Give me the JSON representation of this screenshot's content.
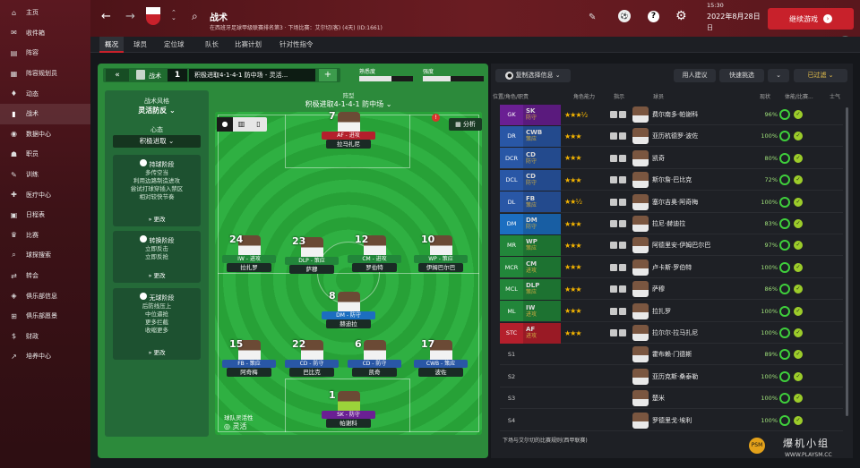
{
  "app": {
    "title": "战术",
    "subtitle": "在西班牙足球甲级联赛排名第3 · 下场比赛：艾尔切(客) (4天) (ID:1661)",
    "time": "2022年8月28日",
    "day": "日",
    "clock": "15:30",
    "continue_label": "继续游戏",
    "badge_count": "6",
    "colors": {
      "accent": "#c8212b",
      "sidebar": "#4d1318"
    }
  },
  "sidebar": {
    "items": [
      {
        "icon": "home-icon",
        "glyph": "⌂",
        "label": "主页"
      },
      {
        "icon": "inbox-icon",
        "glyph": "✉",
        "label": "收件箱"
      },
      {
        "icon": "squad-icon",
        "glyph": "▤",
        "label": "阵容"
      },
      {
        "icon": "squad-plan-icon",
        "glyph": "▦",
        "label": "阵容规划员"
      },
      {
        "icon": "dynamics-icon",
        "glyph": "♦",
        "label": "动态"
      },
      {
        "icon": "tactics-icon",
        "glyph": "▮",
        "label": "战术"
      },
      {
        "icon": "data-hub-icon",
        "glyph": "◉",
        "label": "数据中心"
      },
      {
        "icon": "staff-icon",
        "glyph": "☗",
        "label": "职员"
      },
      {
        "icon": "training-icon",
        "glyph": "✎",
        "label": "训练"
      },
      {
        "icon": "medical-icon",
        "glyph": "✚",
        "label": "医疗中心"
      },
      {
        "icon": "schedule-icon",
        "glyph": "▣",
        "label": "日程表"
      },
      {
        "icon": "competitions-icon",
        "glyph": "♛",
        "label": "比赛"
      },
      {
        "icon": "scouting-icon",
        "glyph": "⌕",
        "label": "球探搜索"
      },
      {
        "icon": "transfers-icon",
        "glyph": "⇄",
        "label": "转会"
      },
      {
        "icon": "club-info-icon",
        "glyph": "◈",
        "label": "俱乐部信息"
      },
      {
        "icon": "club-vision-icon",
        "glyph": "⊞",
        "label": "俱乐部愿景"
      },
      {
        "icon": "finances-icon",
        "glyph": "$",
        "label": "财政"
      },
      {
        "icon": "dev-centre-icon",
        "glyph": "↗",
        "label": "培养中心"
      }
    ]
  },
  "tabs": [
    "概况",
    "球员",
    "定位球",
    "队长",
    "比赛计划",
    "针对性指令"
  ],
  "tactic": {
    "header_label": "战术",
    "slot": "1",
    "name": "积极进取4-1-4-1 防中场 - 灵活...",
    "familiarity_label": "熟悉度",
    "intensity_label": "强度",
    "formation_label": "阵型",
    "formation": "积极进取4-1-4-1 防中场",
    "style_label": "战术风格",
    "style": "灵活防反",
    "mentality_label": "心态",
    "mentality": "积极进取",
    "phases": [
      {
        "title": "持球阶段",
        "lines": [
          "多传空当",
          "利用边路制造进攻",
          "尝试打球穿插入禁区",
          "相对较快节奏"
        ],
        "more": "更改"
      },
      {
        "title": "转换阶段",
        "lines": [
          "立即反击",
          "立即反抢"
        ],
        "more": "更改"
      },
      {
        "title": "无球阶段",
        "lines": [
          "后防线压上",
          "中位逼抢",
          "更多拦截",
          "收缩更多"
        ],
        "more": "更改"
      }
    ],
    "analysis_label": "分析",
    "fluidity_label": "球队灵活性",
    "fluidity": "灵活"
  },
  "pitch_players": [
    {
      "num": "7",
      "role": "AF - 进攻",
      "cls": "at",
      "name": "拉马扎尼"
    },
    {
      "num": "24",
      "role": "IW - 进攻",
      "cls": "mf",
      "name": "拉扎罗"
    },
    {
      "num": "23",
      "role": "DLP - 策应",
      "cls": "mf",
      "name": "萨穆"
    },
    {
      "num": "12",
      "role": "CM - 进攻",
      "cls": "mf",
      "name": "罗伯特"
    },
    {
      "num": "10",
      "role": "WP - 策应",
      "cls": "mf",
      "name": "伊姆巴尔巴"
    },
    {
      "num": "8",
      "role": "DM - 防守",
      "cls": "dm",
      "name": "赫迪拉"
    },
    {
      "num": "15",
      "role": "FB - 策应",
      "cls": "df",
      "name": "阿奇梅"
    },
    {
      "num": "22",
      "role": "CD - 防守",
      "cls": "df",
      "name": "巴比克"
    },
    {
      "num": "6",
      "role": "CD - 防守",
      "cls": "df",
      "name": "凯奇"
    },
    {
      "num": "17",
      "role": "CWB - 策应",
      "cls": "df",
      "name": "波佐"
    },
    {
      "num": "1",
      "role": "SK - 防守",
      "cls": "gk",
      "name": "帕谢科"
    }
  ],
  "selection": {
    "copy_label": "复制选择信息",
    "advice_label": "用人建议",
    "quick_label": "快速挑选",
    "filter_label": "已过滤",
    "headers": {
      "pos": "位置/角色/职责",
      "ability": "角色能力",
      "instr": "指示",
      "player": "球员",
      "state": "现状",
      "fitness": "体能/比赛...",
      "morale": "士气"
    },
    "rows": [
      {
        "pos": "GK",
        "r1": "SK",
        "r2": "防守",
        "stars": "★★★½",
        "name": "费尔南多·帕谢科",
        "state": "",
        "fit": "96%",
        "cls": "gk"
      },
      {
        "pos": "DR",
        "r1": "CWB",
        "r2": "策应",
        "stars": "★★★",
        "name": "亚历杭德罗·波佐",
        "state": "",
        "fit": "100%",
        "cls": "df"
      },
      {
        "pos": "DCR",
        "r1": "CD",
        "r2": "防守",
        "stars": "★★★",
        "name": "凯奇",
        "state": "",
        "fit": "80%",
        "cls": "df"
      },
      {
        "pos": "DCL",
        "r1": "CD",
        "r2": "防守",
        "stars": "★★★",
        "name": "斯尔詹·巴比克",
        "state": "",
        "fit": "72%",
        "cls": "df"
      },
      {
        "pos": "DL",
        "r1": "FB",
        "r2": "策应",
        "stars": "★★½",
        "name": "塞尔吉奥·阿奇梅",
        "state": "",
        "fit": "100%",
        "cls": "df"
      },
      {
        "pos": "DM",
        "r1": "DM",
        "r2": "防守",
        "stars": "★★★",
        "name": "拉尼·赫迪拉",
        "state": "",
        "fit": "83%",
        "cls": "dm"
      },
      {
        "pos": "MR",
        "r1": "WP",
        "r2": "策应",
        "stars": "★★★",
        "name": "阿德里安·伊姆巴尔巴",
        "state": "",
        "fit": "97%",
        "cls": "mf"
      },
      {
        "pos": "MCR",
        "r1": "CM",
        "r2": "进攻",
        "stars": "★★★",
        "name": "卢卡斯·罗伯特",
        "state": "",
        "fit": "100%",
        "cls": "mf"
      },
      {
        "pos": "MCL",
        "r1": "DLP",
        "r2": "策应",
        "stars": "★★★",
        "name": "萨穆",
        "state": "",
        "fit": "86%",
        "cls": "mf"
      },
      {
        "pos": "ML",
        "r1": "IW",
        "r2": "进攻",
        "stars": "★★★",
        "name": "拉扎罗",
        "state": "",
        "fit": "100%",
        "cls": "mf"
      },
      {
        "pos": "STC",
        "r1": "AF",
        "r2": "进攻",
        "stars": "★★★",
        "name": "拉尔尔·拉马扎尼",
        "state": "",
        "fit": "100%",
        "cls": "at"
      },
      {
        "pos": "S1",
        "r1": "",
        "r2": "",
        "stars": "",
        "name": "霍布赖·门德斯",
        "state": "",
        "fit": "89%",
        "cls": "sub"
      },
      {
        "pos": "S2",
        "r1": "",
        "r2": "",
        "stars": "",
        "name": "亚历克斯·桑泰勒",
        "state": "",
        "fit": "100%",
        "cls": "sub"
      },
      {
        "pos": "S3",
        "r1": "",
        "r2": "",
        "stars": "",
        "name": "楚米",
        "state": "",
        "fit": "100%",
        "cls": "sub"
      },
      {
        "pos": "S4",
        "r1": "",
        "r2": "",
        "stars": "",
        "name": "罗德里戈·埃利",
        "state": "",
        "fit": "100%",
        "cls": "sub"
      }
    ],
    "footer": "下场与艾尔切的比赛规则(西甲联赛)"
  },
  "watermark": {
    "title": "爆机小组",
    "url": "WWW.PLAYSM.CC"
  }
}
